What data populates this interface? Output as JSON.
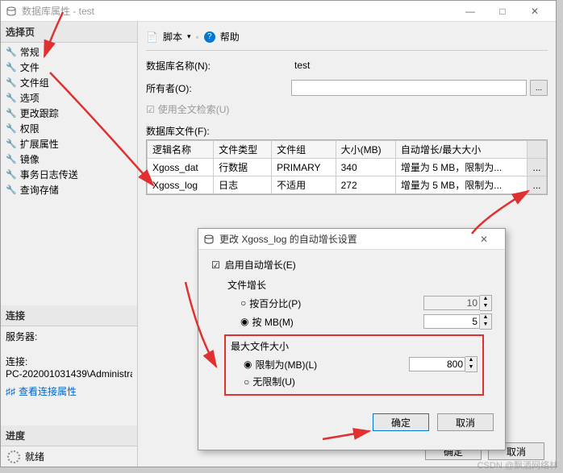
{
  "window": {
    "title": "数据库属性 - test",
    "btn_min": "—",
    "btn_max": "□",
    "btn_close": "✕"
  },
  "sidebar": {
    "select_page": "选择页",
    "items": [
      "常规",
      "文件",
      "文件组",
      "选项",
      "更改跟踪",
      "权限",
      "扩展属性",
      "镜像",
      "事务日志传送",
      "查询存储"
    ],
    "connection": "连接",
    "server_lbl": "服务器:",
    "conn_lbl": "连接:",
    "conn_val": "PC-202001031439\\Administrat",
    "view_conn": "查看连接属性",
    "progress": "进度",
    "ready": "就绪"
  },
  "toolbar": {
    "script": "脚本",
    "help": "帮助",
    "arrow": "▾"
  },
  "form": {
    "dbname_lbl": "数据库名称(N):",
    "dbname_val": "test",
    "owner_lbl": "所有者(O):",
    "owner_val": "",
    "elips": "...",
    "fulltext": "使用全文检索(U)",
    "files_lbl": "数据库文件(F):"
  },
  "grid": {
    "headers": [
      "逻辑名称",
      "文件类型",
      "文件组",
      "大小(MB)",
      "自动增长/最大大小",
      ""
    ],
    "rows": [
      [
        "Xgoss_dat",
        "行数据",
        "PRIMARY",
        "340",
        "增量为 5 MB，限制为...",
        "..."
      ],
      [
        "Xgoss_log",
        "日志",
        "不适用",
        "272",
        "增量为 5 MB，限制为...",
        "..."
      ]
    ]
  },
  "modal": {
    "title": "更改 Xgoss_log 的自动增长设置",
    "close": "✕",
    "enable": "启用自动增长(E)",
    "filegrowth": "文件增长",
    "by_percent": "按百分比(P)",
    "by_mb": "按 MB(M)",
    "percent_val": "10",
    "mb_val": "5",
    "maxsize": "最大文件大小",
    "limit_mb": "限制为(MB)(L)",
    "limit_val": "800",
    "unlimited": "无限制(U)",
    "ok": "确定",
    "cancel": "取消"
  },
  "footer": {
    "ok": "确定",
    "cancel": "取消"
  },
  "watermark": "CSDN @飘洒网络林"
}
